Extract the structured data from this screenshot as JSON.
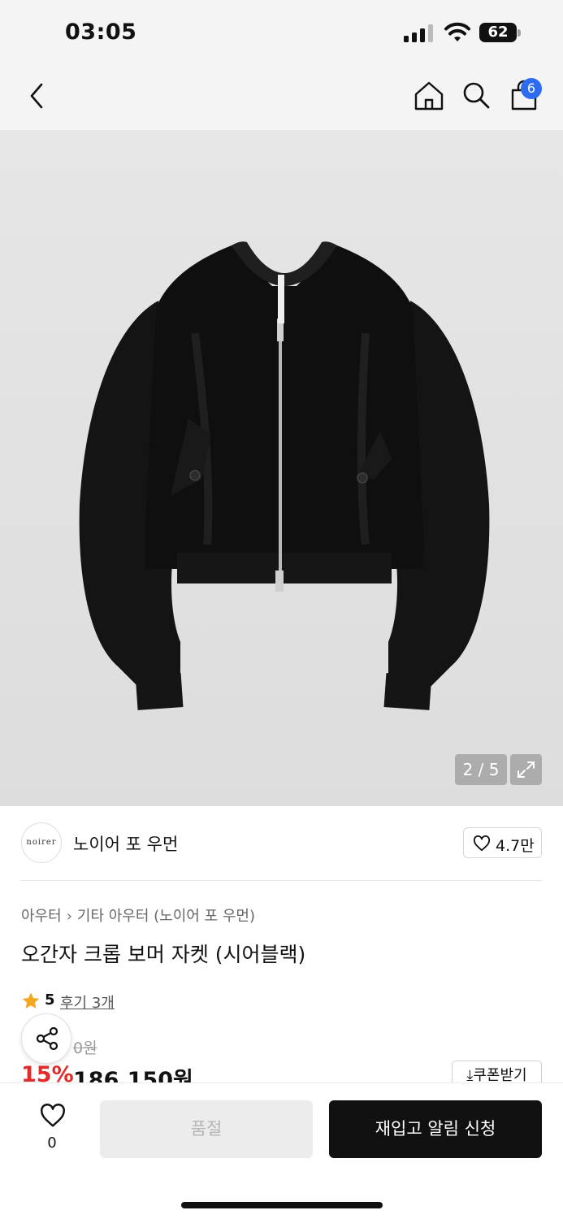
{
  "status_bar": {
    "time": "03:05",
    "battery": "62"
  },
  "header": {
    "cart_count": "6",
    "icons": [
      "back-icon",
      "home-icon",
      "search-icon",
      "shopping-bag-icon"
    ]
  },
  "gallery": {
    "counter": "2 / 5"
  },
  "brand": {
    "logo_text": "noirer",
    "name": "노이어 포 우먼",
    "likes": "4.7만"
  },
  "product": {
    "breadcrumb": [
      "아우터",
      "기타 아우터 (노이어 포 우먼)"
    ],
    "title": "오간자 크롭 보머 자켓 (시어블랙)",
    "rating": "5",
    "reviews": "후기 3개",
    "original_price": "0원",
    "discount": "15%",
    "price": "186,150원",
    "coupon_label": "쿠폰받기"
  },
  "bottom_bar": {
    "wish_count": "0",
    "soldout_label": "품절",
    "restock_label": "재입고 알림 신청"
  },
  "colors": {
    "accent_blue": "#2d6cf0",
    "discount_red": "#e12b2b",
    "star": "#f5a623"
  }
}
